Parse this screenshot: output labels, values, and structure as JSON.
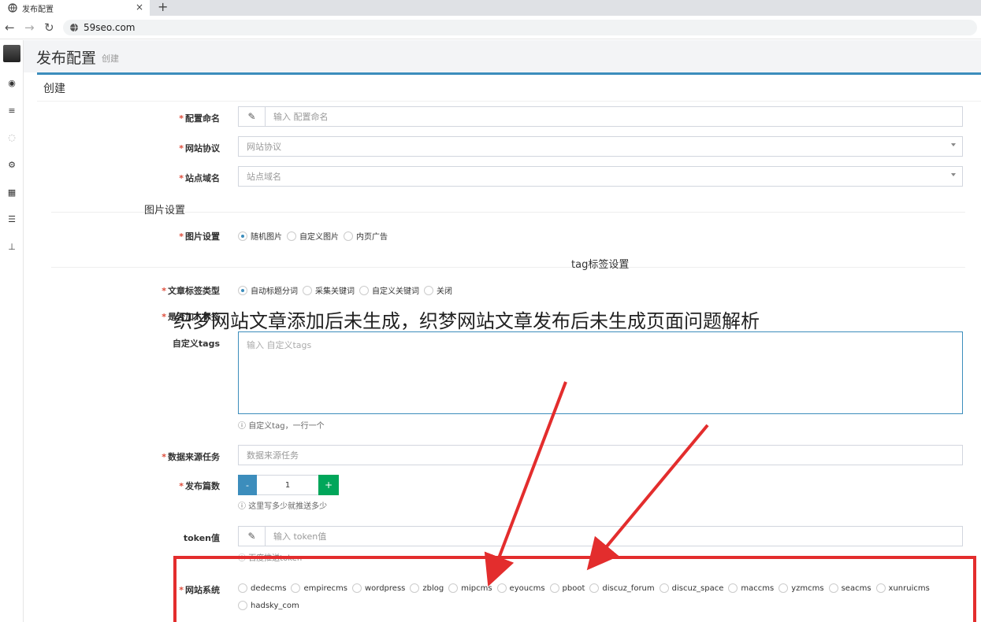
{
  "browser": {
    "tab_title": "发布配置",
    "new_tab": "+",
    "close": "×",
    "url": "59seo.com"
  },
  "header": {
    "title": "发布配置",
    "subtitle": "创建"
  },
  "box": {
    "title": "创建"
  },
  "form": {
    "config_name": {
      "label": "配置命名",
      "placeholder": "输入 配置命名"
    },
    "site_protocol": {
      "label": "网站协议",
      "placeholder": "网站协议"
    },
    "site_domain": {
      "label": "站点域名",
      "placeholder": "站点域名"
    },
    "image_section": "图片设置",
    "image_setting": {
      "label": "图片设置",
      "options": [
        "随机图片",
        "自定义图片",
        "内页广告"
      ],
      "selected": 0
    },
    "tag_section": "tag标签设置",
    "tag_type": {
      "label": "文章标签类型",
      "options": [
        "自动标题分词",
        "采集关键词",
        "自定义关键词",
        "关闭"
      ],
      "selected": 0
    },
    "hidden_label": "是否加入标签",
    "custom_tags": {
      "label": "自定义tags",
      "placeholder": "输入 自定义tags",
      "help": "自定义tag，一行一个"
    },
    "data_source": {
      "label": "数据来源任务",
      "placeholder": "数据来源任务"
    },
    "publish_count": {
      "label": "发布篇数",
      "value": "1",
      "minus": "-",
      "plus": "+",
      "help": "这里写多少就推送多少"
    },
    "token": {
      "label": "token值",
      "placeholder": "输入 token值",
      "help": "百度推送token"
    },
    "cms": {
      "label": "网站系统",
      "options": [
        "dedecms",
        "empirecms",
        "wordpress",
        "zblog",
        "mipcms",
        "eyoucms",
        "pboot",
        "discuz_forum",
        "discuz_space",
        "maccms",
        "yzmcms",
        "seacms",
        "xunruicms",
        "hadsky_com"
      ]
    }
  },
  "overlay_title": "织梦网站文章添加后未生成，织梦网站文章发布后未生成页面问题解析",
  "colors": {
    "accent": "#3c8dbc",
    "success": "#00a65a",
    "annotation": "#e32d2d"
  }
}
